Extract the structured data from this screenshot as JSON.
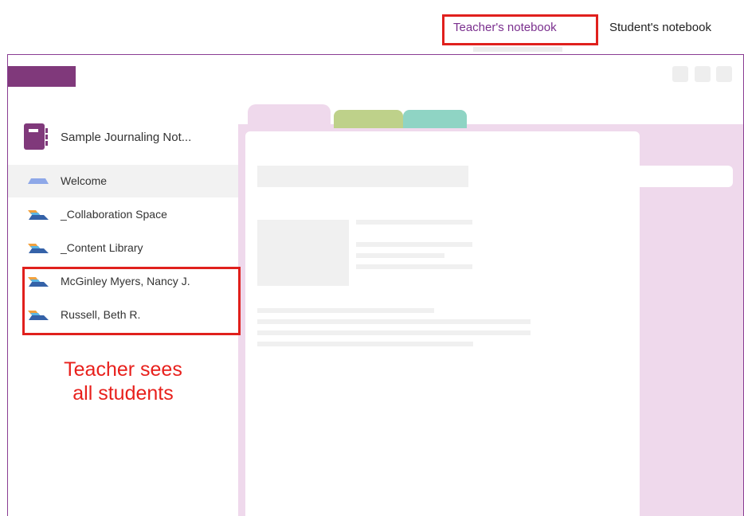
{
  "view_tabs": {
    "teacher": "Teacher's notebook",
    "student": "Student's notebook",
    "active": "teacher"
  },
  "notebook": {
    "title": "Sample Journaling Not..."
  },
  "sections": [
    {
      "label": "Welcome",
      "selected": true,
      "icon": "section-tab-icon-blue"
    },
    {
      "label": "_Collaboration Space",
      "selected": false,
      "icon": "section-group-icon"
    },
    {
      "label": "_Content Library",
      "selected": false,
      "icon": "section-group-icon"
    },
    {
      "label": "McGinley Myers, Nancy J.",
      "selected": false,
      "icon": "section-group-icon"
    },
    {
      "label": "Russell, Beth R.",
      "selected": false,
      "icon": "section-group-icon"
    }
  ],
  "annotation": {
    "line1": "Teacher sees",
    "line2": "all students"
  },
  "colors": {
    "brand": "#80397b",
    "accent_text": "#7a2f8e",
    "highlight": "#e0201d",
    "page_background": "#efd9ec",
    "tab_green": "#bed18a",
    "tab_teal": "#8fd4c4"
  }
}
